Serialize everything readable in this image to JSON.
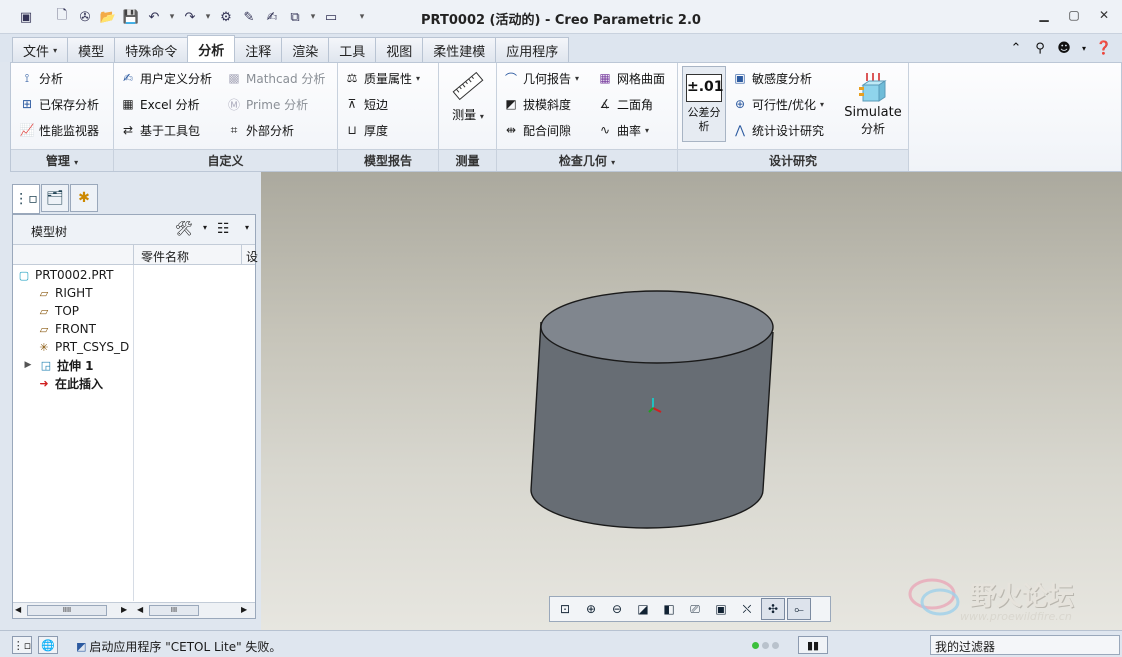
{
  "window": {
    "title": "PRT0002 (活动的) - Creo Parametric 2.0",
    "controls": [
      "minimize-icon",
      "restore-icon",
      "close-icon"
    ]
  },
  "quick_access": [
    "new-icon",
    "open-icon",
    "open-folder-icon",
    "save-icon",
    "undo-icon",
    "redo-icon",
    "regenerate-icon",
    "window-icon",
    "close-window-icon"
  ],
  "tabs": [
    "文件",
    "模型",
    "特殊命令",
    "分析",
    "注释",
    "渲染",
    "工具",
    "视图",
    "柔性建模",
    "应用程序"
  ],
  "active_tab": "分析",
  "ribbon": {
    "manage": {
      "label": "管理",
      "items": [
        "分析",
        "已保存分析",
        "性能监视器"
      ]
    },
    "custom": {
      "label": "自定义",
      "items": [
        "用户定义分析",
        "Excel 分析",
        "基于工具包",
        "Mathcad 分析",
        "Prime 分析",
        "外部分析"
      ]
    },
    "model_report": {
      "label": "模型报告",
      "items": [
        "质量属性",
        "短边",
        "厚度"
      ]
    },
    "measure": {
      "label": "测量",
      "button": "测量"
    },
    "inspect": {
      "label": "检查几何",
      "items": [
        "几何报告",
        "拔模斜度",
        "配合间隙",
        "网格曲面",
        "二面角",
        "曲率"
      ]
    },
    "design_study": {
      "label": "设计研究",
      "tolerance": "公差分析",
      "tolerance_icon": "±.01",
      "items": [
        "敏感度分析",
        "可行性/优化",
        "统计设计研究"
      ],
      "simulate_line1": "Simulate",
      "simulate_line2": "分析"
    }
  },
  "model_tree": {
    "header": "模型树",
    "column1": "零件名称",
    "column2": "设",
    "root": "PRT0002.PRT",
    "nodes": [
      "RIGHT",
      "TOP",
      "FRONT",
      "PRT_CSYS_D",
      "拉伸 1",
      "在此插入"
    ]
  },
  "status": {
    "message": "启动应用程序 \"CETOL Lite\" 失败。",
    "filter": "我的过滤器"
  },
  "watermark": {
    "text": "野火论坛",
    "url": "www.proewildfire.cn"
  },
  "colors": {
    "ribbon_bg": "#f0f3f8",
    "viewport_top": "#aba99e",
    "viewport_bottom": "#e7e6e0",
    "part": "#6b7178",
    "part_top": "#848a92"
  }
}
